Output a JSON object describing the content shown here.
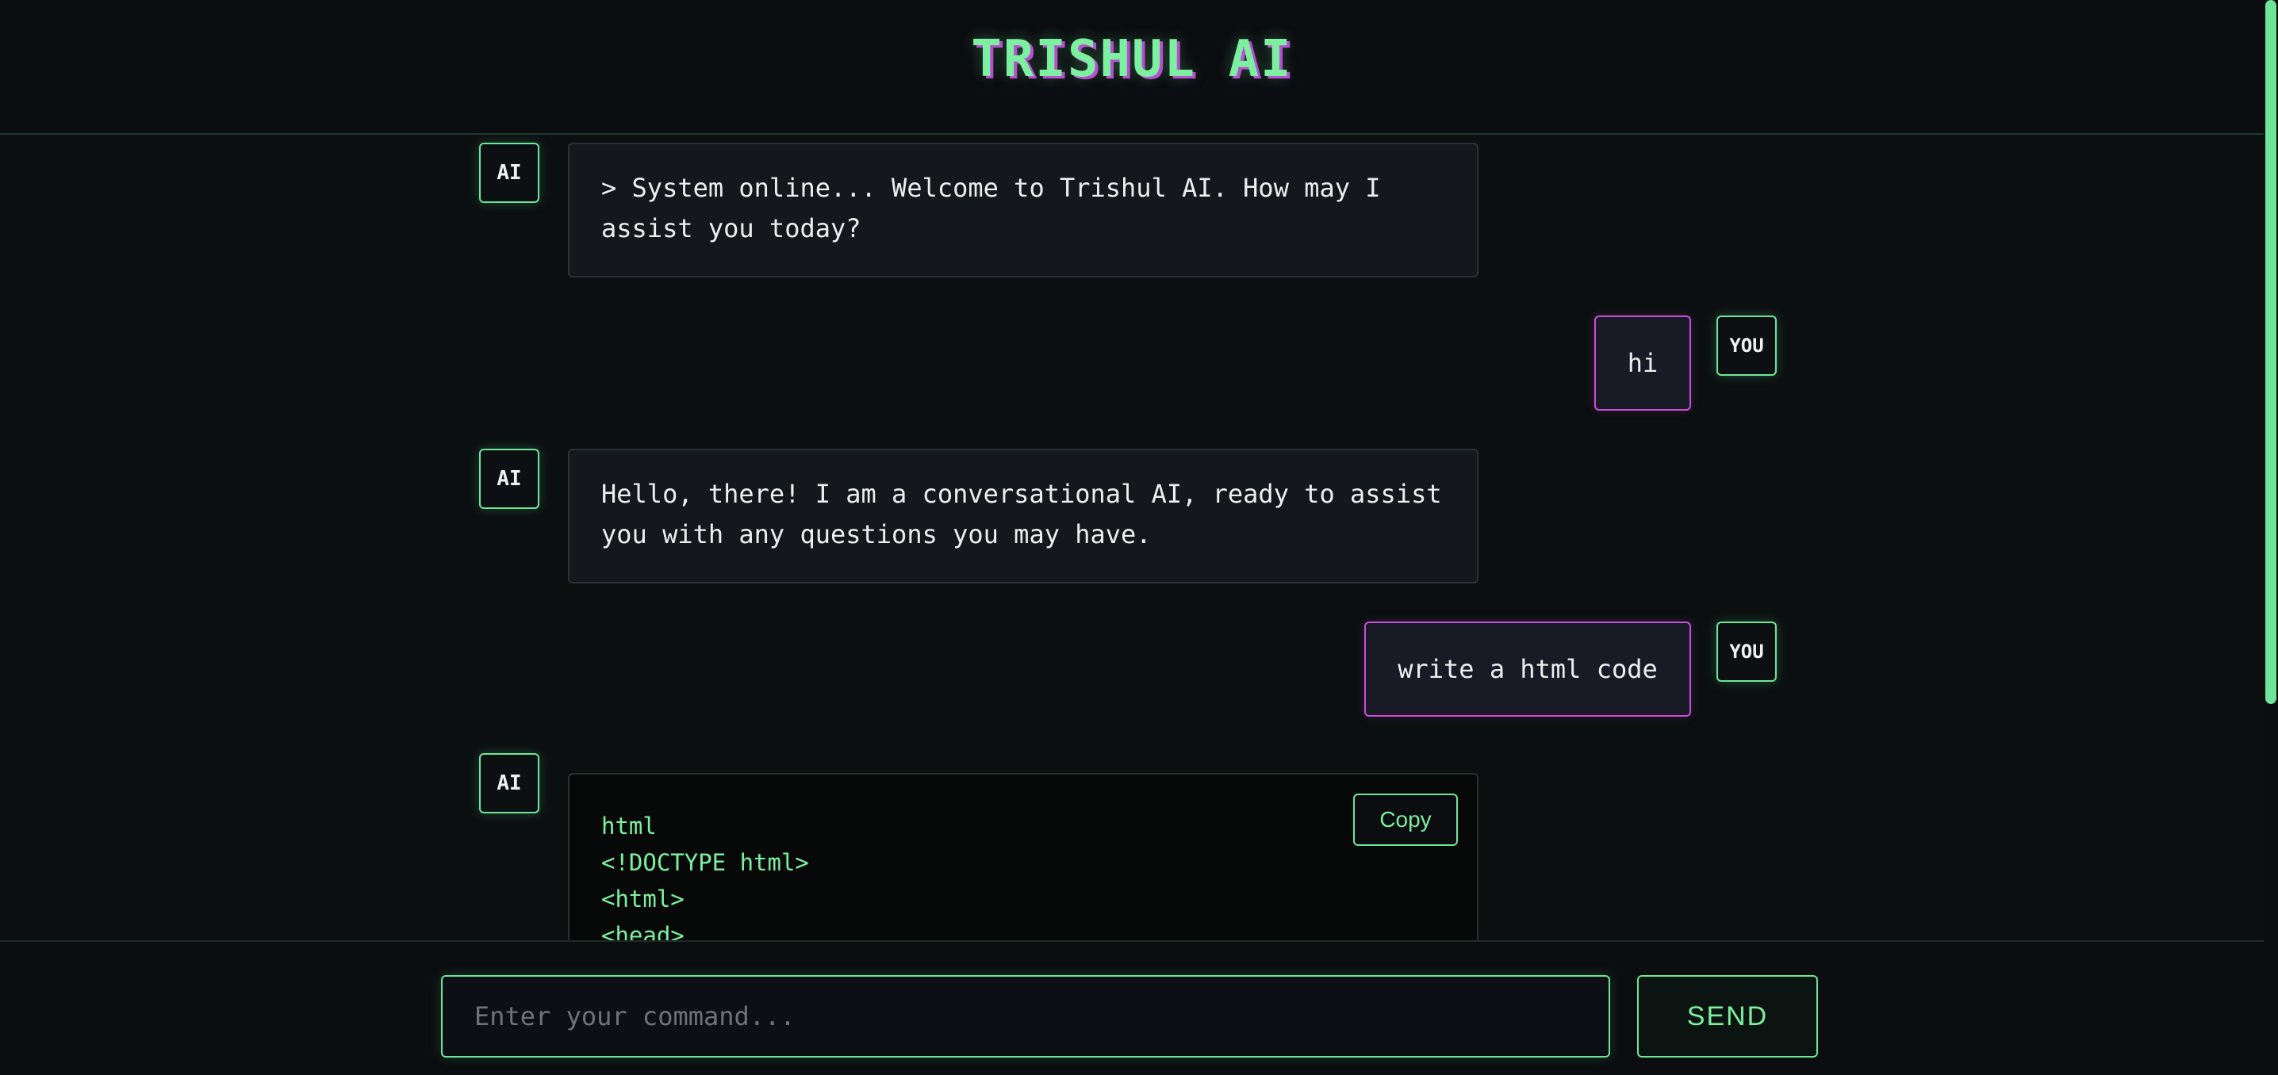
{
  "header": {
    "title": "TRISHUL AI"
  },
  "messages": [
    {
      "role": "ai",
      "avatar_label": "AI",
      "text": "> System online... Welcome to Trishul AI. How may I assist you today?"
    },
    {
      "role": "user",
      "avatar_label": "YOU",
      "text": "hi"
    },
    {
      "role": "ai",
      "avatar_label": "AI",
      "text": "Hello, there! I am a conversational AI, ready to assist you with any questions you may have."
    },
    {
      "role": "user",
      "avatar_label": "YOU",
      "text": "write a html code"
    },
    {
      "role": "ai",
      "avatar_label": "AI",
      "code": {
        "copy_label": "Copy",
        "lines": [
          "html",
          "<!DOCTYPE html>",
          "<html>",
          "<head>"
        ]
      }
    }
  ],
  "composer": {
    "placeholder": "Enter your command...",
    "value": "",
    "send_label": "SEND"
  },
  "colors": {
    "accent": "#6ee69a",
    "user_border": "#c84fd8",
    "background": "#0b0d10"
  }
}
